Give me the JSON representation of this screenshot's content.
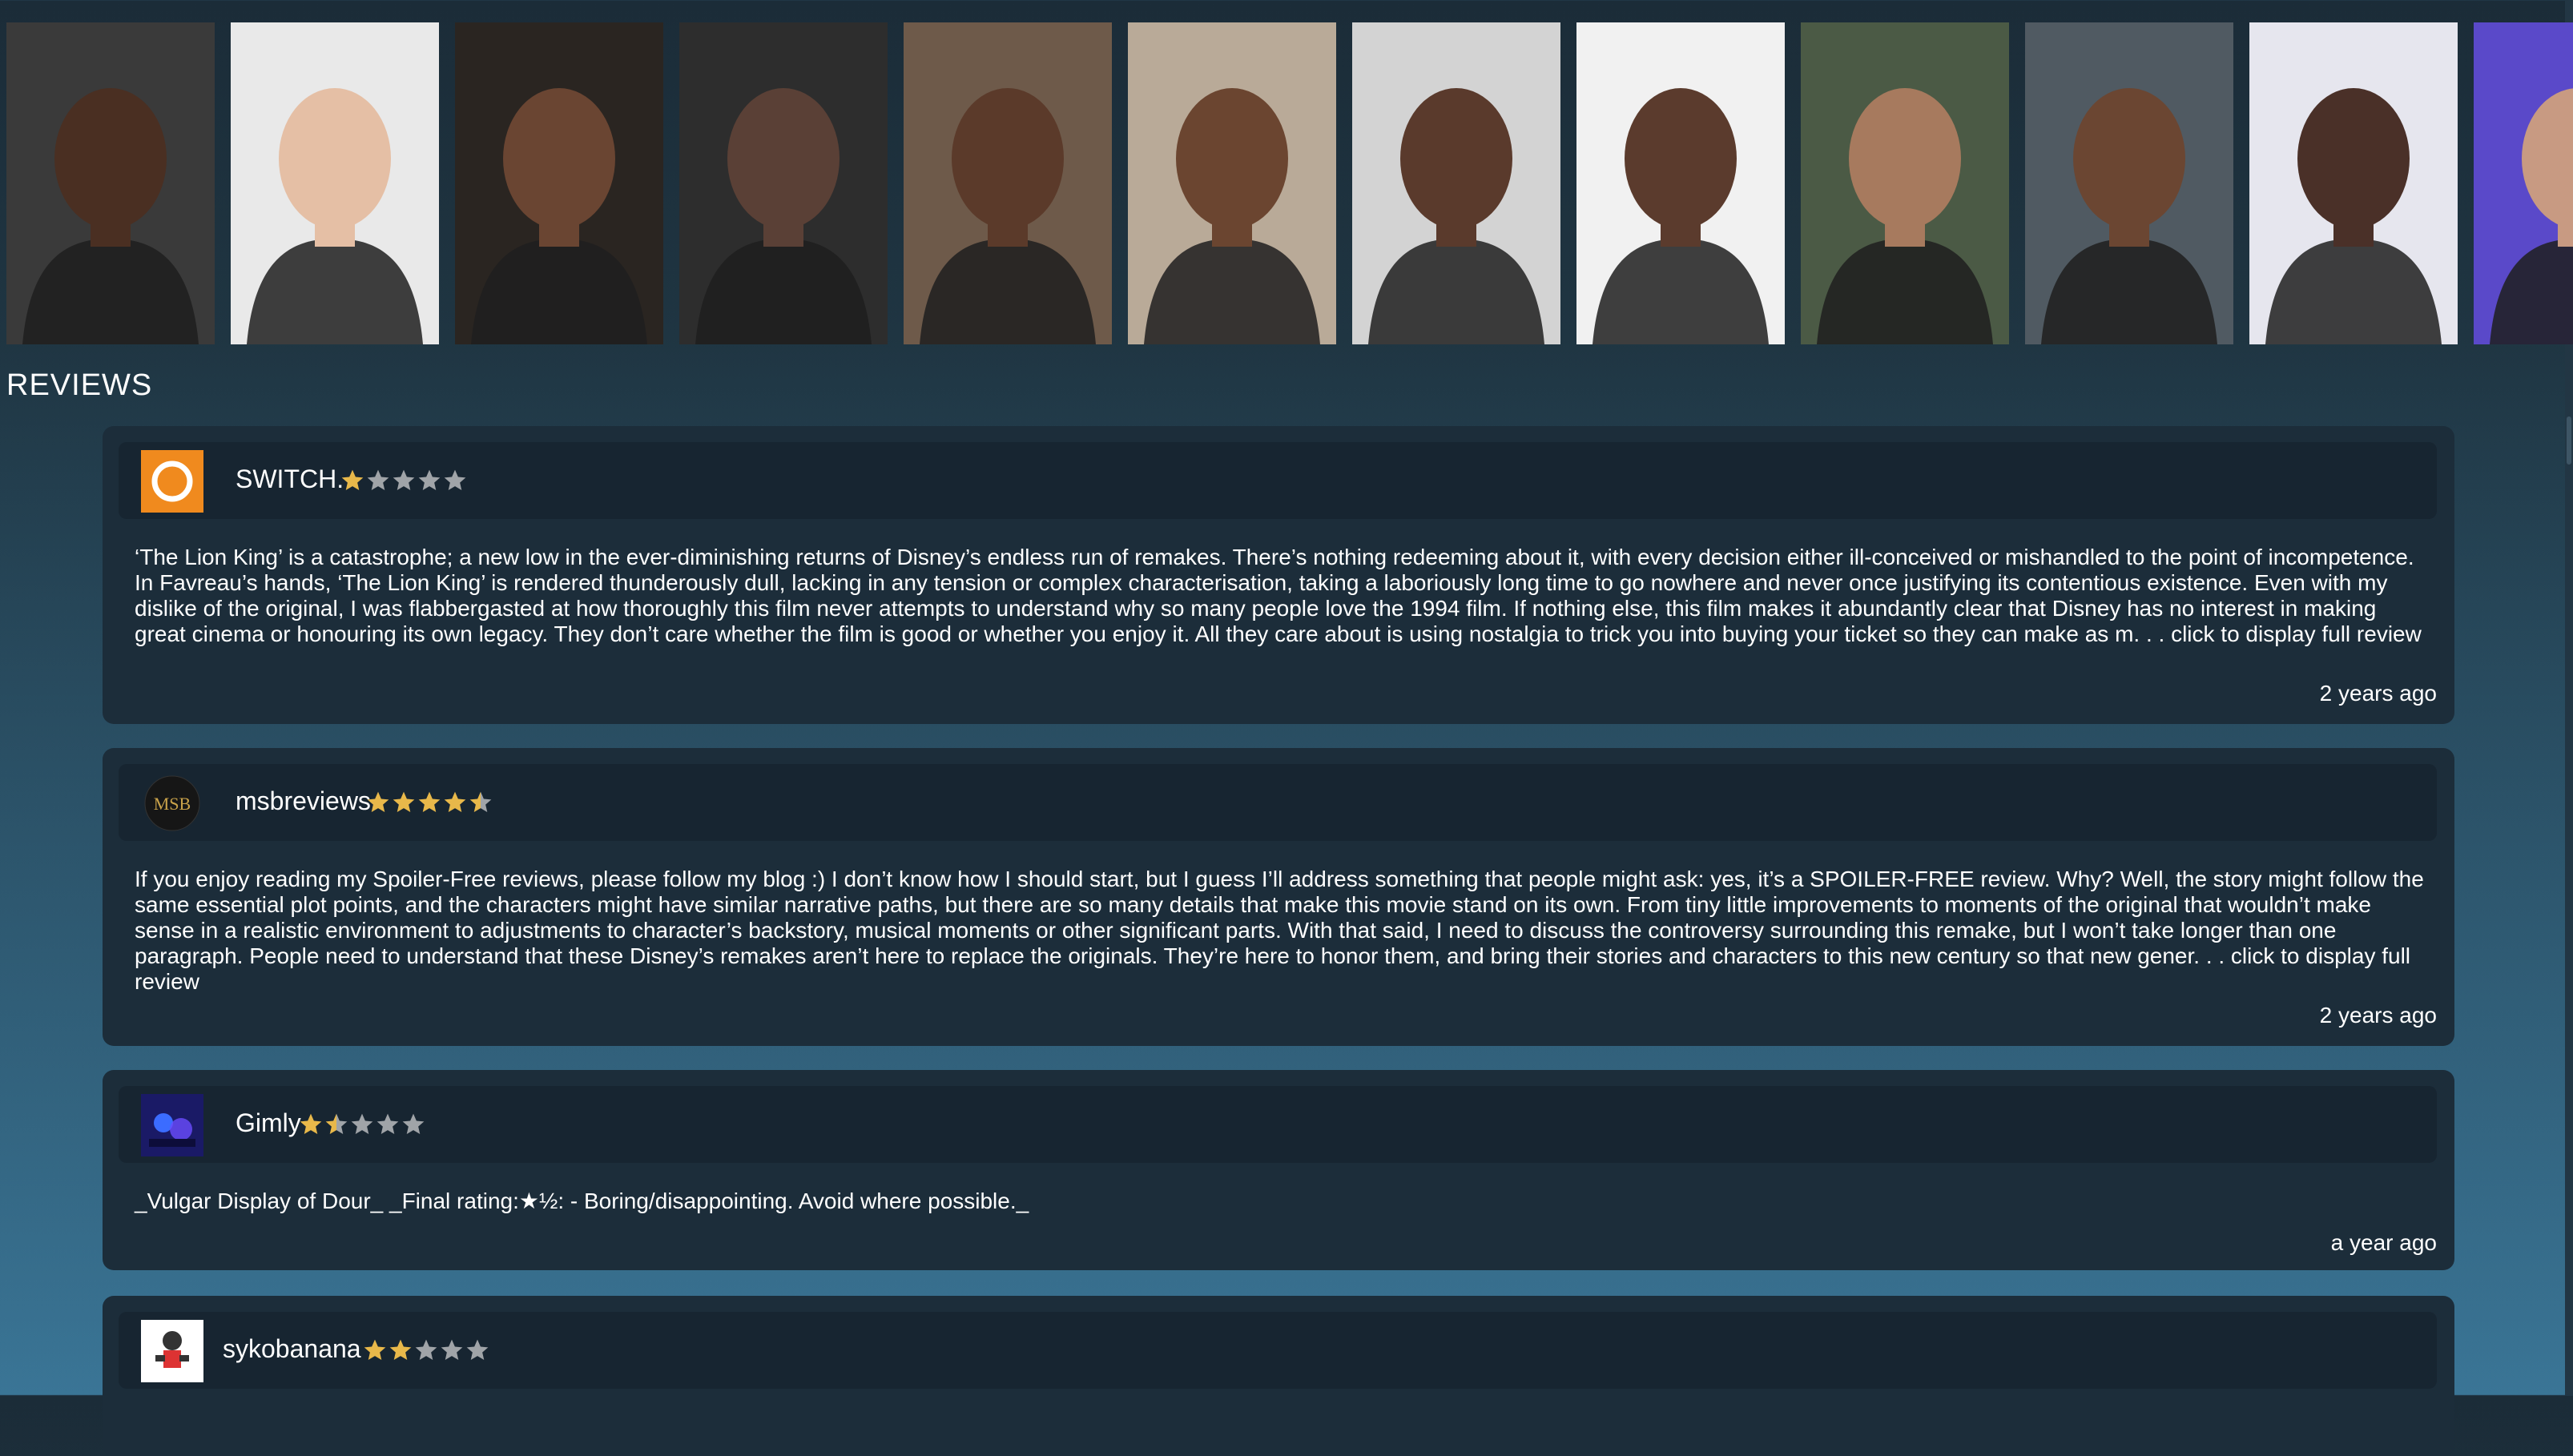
{
  "section": {
    "heading": "REVIEWS"
  },
  "cast": [
    {
      "icon": "cast-photo-1",
      "bg": "#3a3a3a",
      "skin": "#4a2f22"
    },
    {
      "icon": "cast-photo-2",
      "bg": "#e9e9e9",
      "skin": "#e5bfa5"
    },
    {
      "icon": "cast-photo-3",
      "bg": "#2a2521",
      "skin": "#6a4532"
    },
    {
      "icon": "cast-photo-4",
      "bg": "#2d2d2d",
      "skin": "#5a4036"
    },
    {
      "icon": "cast-photo-5",
      "bg": "#6e5a4a",
      "skin": "#5b3a2a"
    },
    {
      "icon": "cast-photo-6",
      "bg": "#b9aa98",
      "skin": "#6b4530"
    },
    {
      "icon": "cast-photo-7",
      "bg": "#d3d3d3",
      "skin": "#5a3a2c"
    },
    {
      "icon": "cast-photo-8",
      "bg": "#f1f1f1",
      "skin": "#5b3b2d"
    },
    {
      "icon": "cast-photo-9",
      "bg": "#4b5a45",
      "skin": "#a77a5e"
    },
    {
      "icon": "cast-photo-10",
      "bg": "#505a62",
      "skin": "#6b4632"
    },
    {
      "icon": "cast-photo-11",
      "bg": "#e6e6ee",
      "skin": "#4a3028"
    },
    {
      "icon": "cast-photo-12",
      "bg": "#5a49c9",
      "skin": "#c89a82"
    }
  ],
  "reviews": [
    {
      "author": "SWITCH.",
      "rating": 1,
      "avatar_icon": "switch-avatar-icon",
      "text": "‘The Lion King’ is a catastrophe; a new low in the ever-diminishing returns of Disney’s endless run of remakes. There’s nothing redeeming about it, with every decision either ill-conceived or mishandled to the point of incompetence. In Favreau’s hands, ‘The Lion King’ is rendered thunderously dull, lacking in any tension or complex characterisation, taking a laboriously long time to go nowhere and never once justifying its contentious existence. Even with my dislike of the original, I was flabbergasted at how thoroughly this film never attempts to understand why so many people love the 1994 film. If nothing else, this film makes it abundantly clear that Disney has no interest in making great cinema or honouring its own legacy. They don’t care whether the film is good or whether you enjoy it. All they care about is using nostalgia to trick you into buying your ticket so they can make as m. . . click to display full review",
      "date": "2 years ago"
    },
    {
      "author": "msbreviews",
      "rating": 4.5,
      "avatar_icon": "msb-logo-avatar-icon",
      "avatar_text": "MSB",
      "text": "If you enjoy reading my Spoiler-Free reviews, please follow my blog :) I don’t know how I should start, but I guess I’ll address something that people might ask: yes, it’s a SPOILER-FREE review. Why? Well, the story might follow the same essential plot points, and the characters might have similar narrative paths, but there are so many details that make this movie stand on its own. From tiny little improvements to moments of the original that wouldn’t make sense in a realistic environment to adjustments to character’s backstory, musical moments or other significant parts. With that said, I need to discuss the controversy surrounding this remake, but I won’t take longer than one paragraph. People need to understand that these Disney’s remakes aren’t here to replace the originals. They’re here to honor them, and bring their stories and characters to this new century so that new gener. . . click to display full review",
      "date": "2 years ago"
    },
    {
      "author": "Gimly",
      "rating": 1.5,
      "avatar_icon": "gimly-avatar-icon",
      "text": "_Vulgar Display of Dour_ _Final rating:★½: - Boring/disappointing. Avoid where possible._",
      "date": "a year ago"
    },
    {
      "author": "sykobanana",
      "rating": 2,
      "avatar_icon": "sykobanana-avatar-icon",
      "text": "",
      "date": ""
    }
  ],
  "colors": {
    "star_fill": "#e8b84a",
    "star_empty": "#a0a4a8"
  }
}
